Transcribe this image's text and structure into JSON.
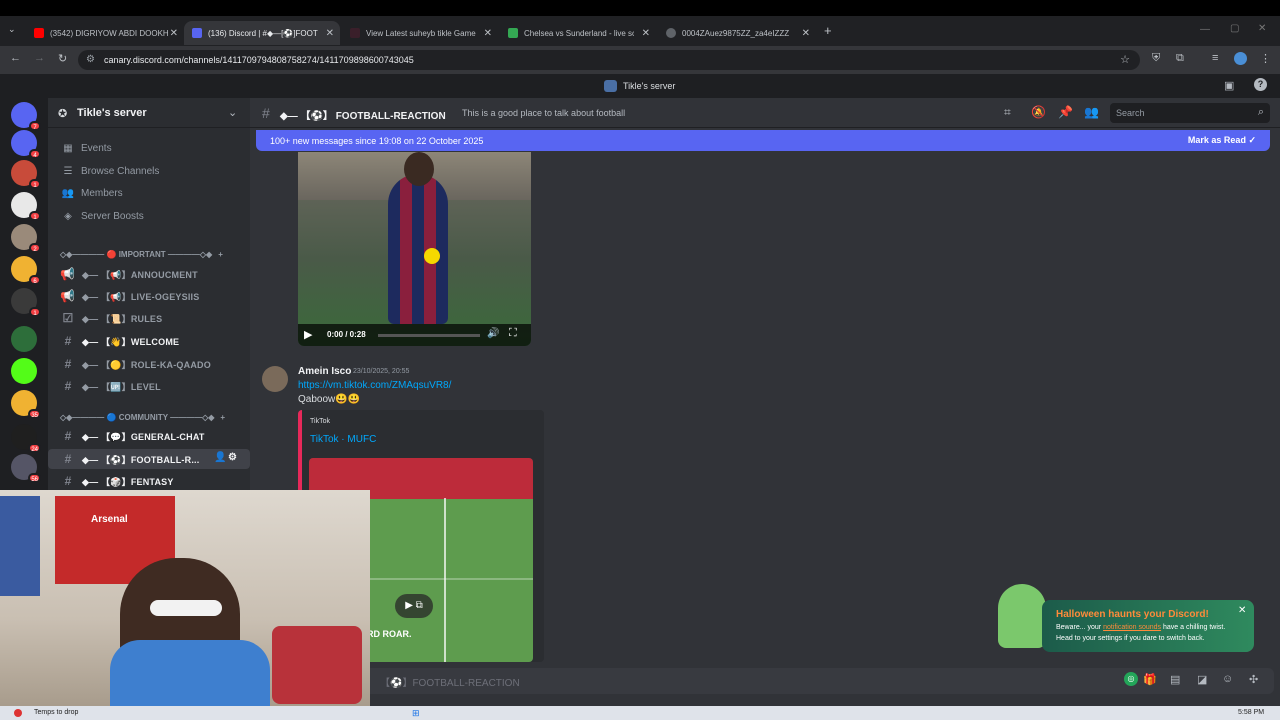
{
  "browser": {
    "tabs": [
      {
        "title": "(3542) DIGRIYOW ABDI DOOKH",
        "color": "#ff0000"
      },
      {
        "title": "(136) Discord | #◆—[⚽]FOOTBALL-REACTION",
        "color": "#5865f2"
      },
      {
        "title": "View Latest suheyb tikle Game",
        "color": "#53fc18"
      },
      {
        "title": "Chelsea vs Sunderland - live sc",
        "color": "#34a853"
      },
      {
        "title": "0004ZAuez9875ZZ_za4eIZZZ",
        "color": "#9aa0a6"
      }
    ],
    "url": "canary.discord.com/channels/1411709794808758274/1411709898600743045"
  },
  "titlebar": {
    "server_name": "Tikle's server"
  },
  "guilds": [
    {
      "name": "discord-home",
      "badge": "7",
      "color": "#5865f2"
    },
    {
      "name": "discord-canary",
      "badge": "4",
      "color": "#5865f2"
    },
    {
      "name": "server-1",
      "badge": "1",
      "color": "#c84b3a"
    },
    {
      "name": "server-2",
      "badge": "1",
      "color": "#e8e8e8"
    },
    {
      "name": "server-3",
      "badge": "2",
      "color": "#9a8a7a"
    },
    {
      "name": "server-4",
      "badge": "6",
      "color": "#f0b232"
    },
    {
      "name": "server-5",
      "badge": "1",
      "color": "#3a3a3a"
    },
    {
      "name": "tikle-server",
      "badge": "",
      "color": "#2d6e3a"
    },
    {
      "name": "kick-server",
      "badge": "",
      "color": "#53fc18"
    },
    {
      "name": "server-6",
      "badge": "35",
      "color": "#f0b232"
    },
    {
      "name": "server-7",
      "badge": "24",
      "color": "#1f1f1f"
    },
    {
      "name": "server-8",
      "badge": "56",
      "color": "#555566"
    }
  ],
  "server": {
    "name": "Tikle's server",
    "menu": [
      "Events",
      "Browse Channels",
      "Members",
      "Server Boosts"
    ],
    "categories": {
      "important": "◇◆———— 🔴 IMPORTANT ————◇◆",
      "community": "◇◆———— 🔵 COMMUNITY ————◇◆"
    },
    "channels": [
      {
        "label": "◆— 【📢】ANNOUCMENT",
        "unread": false
      },
      {
        "label": "◆— 【📢】LIVE-OGEYSIIS",
        "unread": false
      },
      {
        "label": "◆— 【📜】RULES",
        "unread": false
      },
      {
        "label": "◆— 【👋】WELCOME",
        "unread": true
      },
      {
        "label": "◆— 【🟡】ROLE-KA-QAADO",
        "unread": false
      },
      {
        "label": "◆— 【🆙】LEVEL",
        "unread": false
      },
      {
        "label": "◆— 【💬】GENERAL-CHAT",
        "unread": true
      },
      {
        "label": "◆— 【⚽】FOOTBALL-R...",
        "unread": true
      },
      {
        "label": "◆— 【🎲】FENTASY",
        "unread": true
      }
    ]
  },
  "channel": {
    "name": "◆— 【⚽】 FOOTBALL-REACTION",
    "topic": "This is a good place to talk about football",
    "search_placeholder": "Search"
  },
  "banner": {
    "text": "100+ new messages since 19:08 on 22 October 2025",
    "action": "Mark as Read"
  },
  "video": {
    "time": "0:00 / 0:28"
  },
  "message": {
    "author": "Amein Isco",
    "timestamp": "23/10/2025, 20:55",
    "link": "https://vm.tiktok.com/ZMAqsuVR8/",
    "text": "Qaboow😃😃",
    "embed_provider": "TikTok",
    "embed_title": "TikTok · MUFC",
    "embed_caption": "OLD TRAFFORD ROAR."
  },
  "composer": {
    "placeholder": "【⚽】FOOTBALL-REACTION"
  },
  "toast": {
    "title": "Halloween haunts your Discord!",
    "line1_prefix": "Beware... your ",
    "line1_link": "notification sounds",
    "line1_suffix": " have a chilling twist.",
    "line2": "Head to your settings if you dare to switch back."
  },
  "taskbar": {
    "status": "Temps to drop",
    "time": "5:58 PM"
  }
}
